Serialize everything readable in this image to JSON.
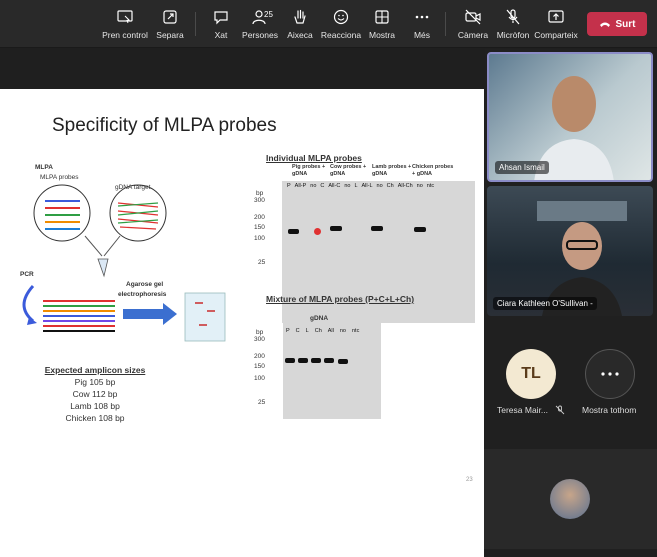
{
  "toolbar": {
    "items": [
      {
        "label": "Pren control",
        "icon": "remote-control-icon"
      },
      {
        "label": "Separa",
        "icon": "pop-out-icon"
      },
      {
        "label": "Xat",
        "icon": "chat-icon"
      },
      {
        "label": "Persones",
        "icon": "people-icon",
        "count": "25"
      },
      {
        "label": "Aixeca",
        "icon": "raise-hand-icon"
      },
      {
        "label": "Reacciona",
        "icon": "react-icon"
      },
      {
        "label": "Mostra",
        "icon": "layout-icon"
      },
      {
        "label": "Més",
        "icon": "more-icon"
      },
      {
        "label": "Càmera",
        "icon": "camera-off-icon"
      },
      {
        "label": "Micròfon",
        "icon": "mic-off-icon"
      },
      {
        "label": "Comparteix",
        "icon": "share-icon"
      }
    ],
    "leave_label": "Surt",
    "leave_color": "#c4314b"
  },
  "slide": {
    "title": "Specificity of MLPA probes",
    "diagram": {
      "mlpa": "MLPA",
      "mlpa_probes": "MLPA probes",
      "gdna_target": "gDNA target",
      "pcr": "PCR",
      "agarose": "Agarose gel",
      "electrophoresis": "electrophoresis"
    },
    "gel1": {
      "title": "Individual MLPA probes",
      "groups": [
        "Pig probes + gDNA",
        "Cow probes + gDNA",
        "Lamb probes + gDNA",
        "Chicken probes + gDNA"
      ],
      "lanes": [
        "P",
        "All-P",
        "no",
        "C",
        "All-C",
        "no",
        "L",
        "All-L",
        "no",
        "Ch",
        "All-Ch",
        "no",
        "ntc"
      ],
      "bp_header": "bp",
      "ladder": [
        "300",
        "200",
        "150",
        "100",
        "25"
      ]
    },
    "gel2": {
      "title": "Mixture of MLPA probes (P+C+L+Ch)",
      "group": "gDNA",
      "lanes": [
        "P",
        "C",
        "L",
        "Ch",
        "All",
        "no",
        "ntc"
      ],
      "bp_header": "bp",
      "ladder": [
        "300",
        "200",
        "150",
        "100",
        "25"
      ]
    },
    "amplicons": {
      "title": "Expected amplicon sizes",
      "items": [
        "Pig 105 bp",
        "Cow 112 bp",
        "Lamb 108 bp",
        "Chicken 108 bp"
      ]
    },
    "page_number": "23"
  },
  "participants": [
    {
      "name": "Ahsan Ismail"
    },
    {
      "name": "Ciara Kathleen O'Sullivan -"
    },
    {
      "name": "Teresa Mair...",
      "initials": "TL",
      "avatar_color": "#f3e9d2"
    },
    {
      "name": "Mostra tothom"
    }
  ]
}
